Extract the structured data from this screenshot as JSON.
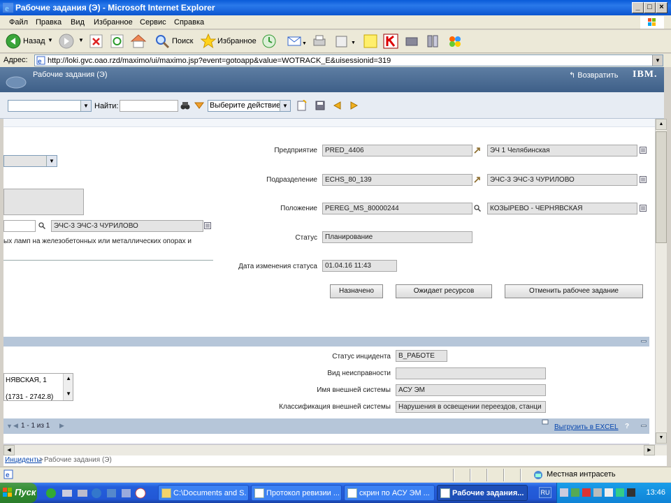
{
  "window": {
    "title": "Рабочие задания (Э) - Microsoft Internet Explorer",
    "controls": [
      "_",
      "□",
      "×"
    ]
  },
  "menu": [
    "Файл",
    "Правка",
    "Вид",
    "Избранное",
    "Сервис",
    "Справка"
  ],
  "toolbar": {
    "back": "Назад",
    "search": "Поиск",
    "favorites": "Избранное"
  },
  "address": {
    "label": "Адрес:",
    "url": "http://loki.gvc.oao.rzd/maximo/ui/maximo.jsp?event=gotoapp&value=WOTRACK_E&uisessionid=319"
  },
  "maximo": {
    "app_title": "Рабочие задания (Э)",
    "return_label": "Возвратить",
    "brand": "IBM.",
    "find_label": "Найти:",
    "action_select": "Выберите действие"
  },
  "form": {
    "enterprise": {
      "label": "Предприятие",
      "code": "PRED_4406",
      "desc": "ЭЧ 1 Челябинская"
    },
    "division": {
      "label": "Подразделение",
      "code": "ECHS_80_139",
      "desc": "ЭЧС-3 ЭЧС-3 ЧУРИЛОВО"
    },
    "location": {
      "label": "Положение",
      "code": "PEREG_MS_80000244",
      "desc": "КОЗЫРЕВО - ЧЕРНЯВСКАЯ"
    },
    "status": {
      "label": "Статус",
      "value": "Планирование"
    },
    "status_date": {
      "label": "Дата изменения статуса",
      "value": "01.04.16 11:43"
    },
    "left_desc": "ЭЧС-3 ЭЧС-3 ЧУРИЛОВО",
    "left_text": "ых ламп на железобетонных или металлических опорах и",
    "buttons": {
      "assigned": "Назначено",
      "await": "Ожидает ресурсов",
      "cancel": "Отменить рабочее задание"
    }
  },
  "incident": {
    "status": {
      "label": "Статус инцидента",
      "value": "В_РАБОТЕ"
    },
    "fault_type": {
      "label": "Вид неисправности",
      "value": ""
    },
    "ext_system": {
      "label": "Имя внешней системы",
      "value": "АСУ ЭМ"
    },
    "ext_class": {
      "label": "Классификация внешней системы",
      "value": "Нарушения в освещении переездов, станци"
    },
    "list_line1": "НЯВСКАЯ, 1",
    "list_line2": "(1731 - 2742.8)"
  },
  "table_bar": {
    "pager": "1 - 1 из 1",
    "export": "Выгрузить в EXCEL",
    "help": "?"
  },
  "breadcrumb": {
    "link": "Инциденты",
    "sep": " > ",
    "current": "Рабочие задания (Э)"
  },
  "statusbar": {
    "zone": "Местная интрасеть"
  },
  "taskbar": {
    "start": "Пуск",
    "tasks": [
      "C:\\Documents and S...",
      "Протокол ревизии ...",
      "скрин по АСУ ЭМ ...",
      "Рабочие задания..."
    ],
    "lang": "RU",
    "clock": "13:46"
  }
}
